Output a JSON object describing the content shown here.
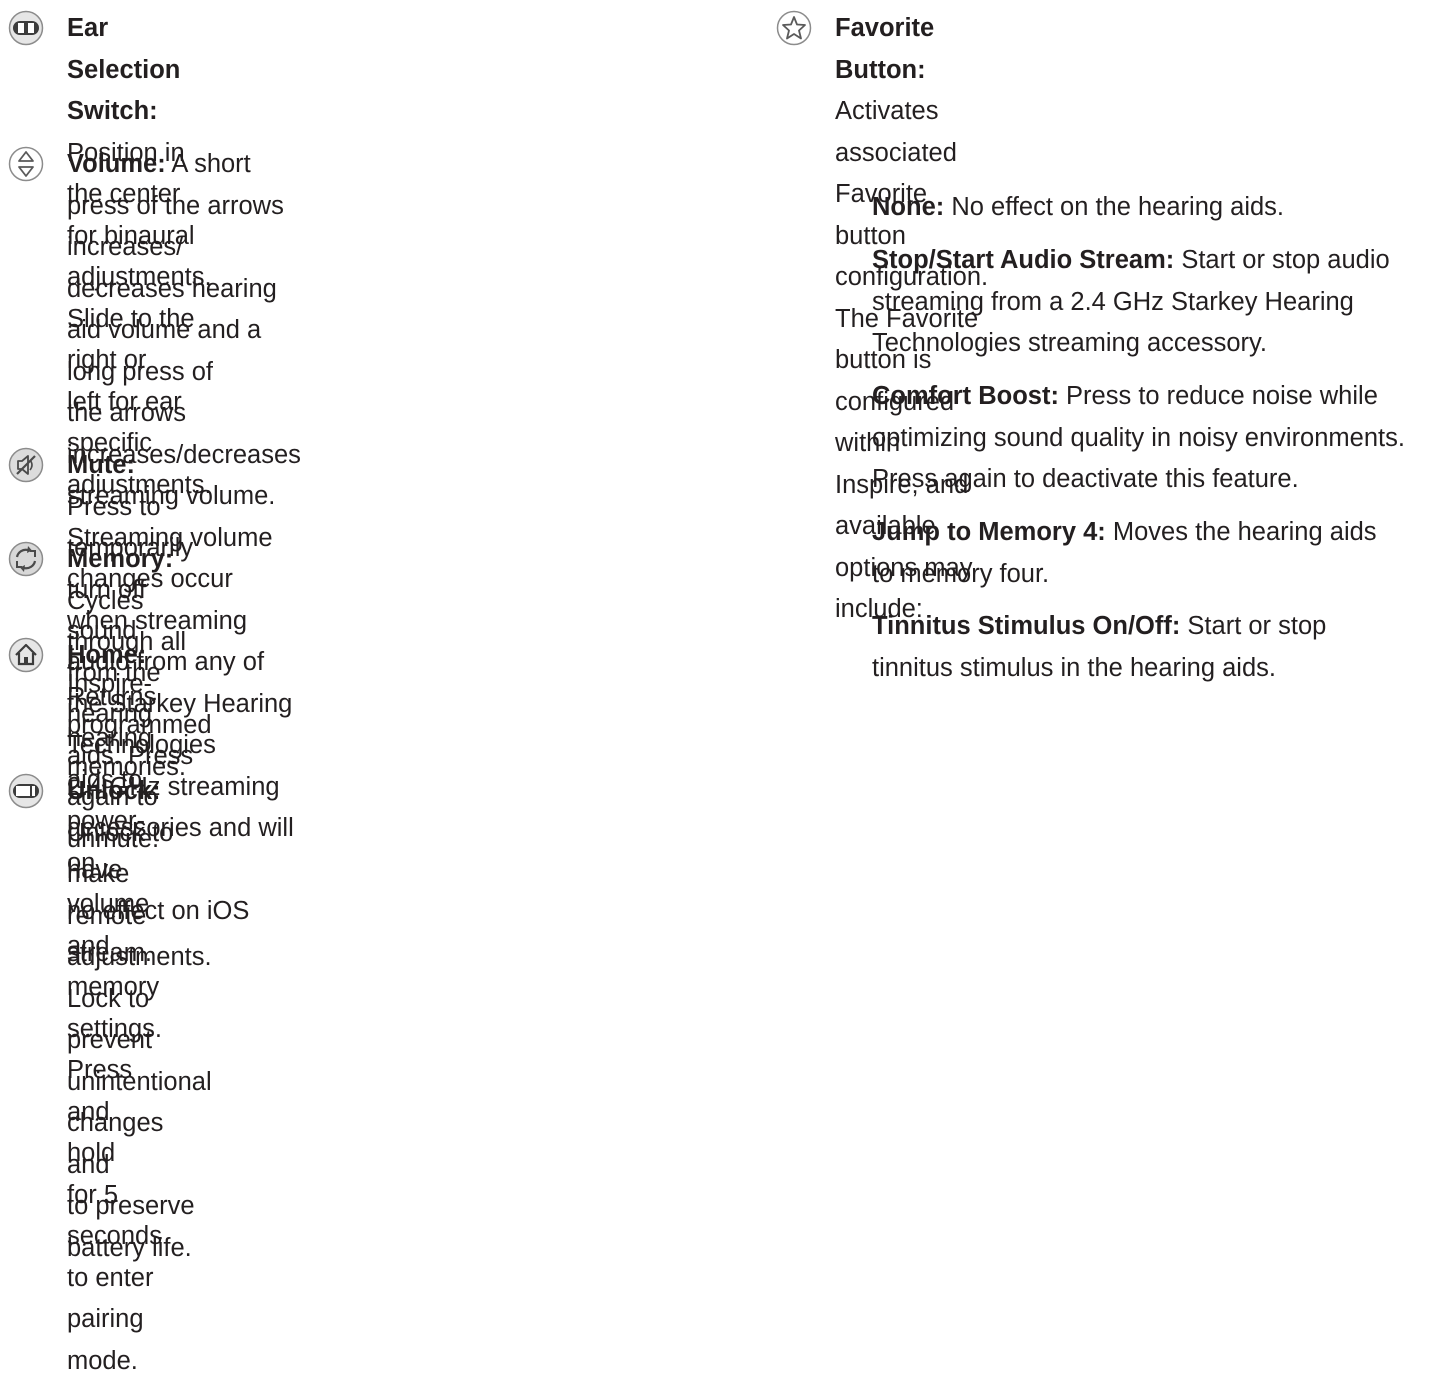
{
  "left_items": [
    {
      "icon": "ear-selection-switch-icon",
      "title": "Ear Selection Switch:",
      "body": " Position in the center\nfor binaural adjustments. Slide to the right or\nleft for ear specific adjustments."
    },
    {
      "icon": "volume-arrows-icon",
      "title": "Volume:",
      "body": " A short press of the arrows increases/\ndecreases hearing aid volume and a long press of\nthe arrows increases/decreases streaming volume.\nStreaming volume changes occur when streaming\naudio from any of the Starkey Hearing Technologies\n2.4 GHz streaming accessories and will have\nno effect on iOS stream."
    },
    {
      "icon": "mute-speaker-icon",
      "title": "Mute:",
      "body": " Press to temporarily turn off sound\nfrom the hearing aids. Press again to unmute."
    },
    {
      "icon": "memory-cycle-icon",
      "title": "Memory:",
      "body": " Cycles through all Inspire-programmed\nmemories."
    },
    {
      "icon": "home-icon",
      "title": "Home:",
      "body": " Returns hearing aids to power-on\nvolume and memory settings. Press and hold\nfor 5 seconds to enter pairing mode."
    },
    {
      "icon": "unlock-switch-icon",
      "title": "Unlock:",
      "body": " Unlock to make remote adjustments.\nLock to prevent unintentional changes and\nto preserve battery life."
    }
  ],
  "favorite": {
    "icon": "star-icon",
    "title": "Favorite Button:",
    "body": " Activates associated\nFavorite button configuration. The Favorite\nbutton is configured within Inspire, and\navailable options may include:"
  },
  "options": [
    {
      "title": "None:",
      "body": " No effect on the hearing aids."
    },
    {
      "title": "Stop/Start Audio Stream:",
      "body": " Start or stop audio\nstreaming from a 2.4 GHz Starkey Hearing\nTechnologies streaming accessory."
    },
    {
      "title": "Comfort Boost:",
      "body": " Press to reduce noise while\noptimizing sound quality in noisy environments.\nPress again to deactivate this feature."
    },
    {
      "title": "Jump to Memory 4:",
      "body": " Moves the hearing aids\nto memory four."
    },
    {
      "title": "Tinnitus Stimulus On/Off:",
      "body": " Start or stop\ntinnitus stimulus in the hearing aids."
    }
  ],
  "colors": {
    "text": "#231f20",
    "icon_ring": "#8c8c8c",
    "icon_fill": "#5a5a5a"
  }
}
